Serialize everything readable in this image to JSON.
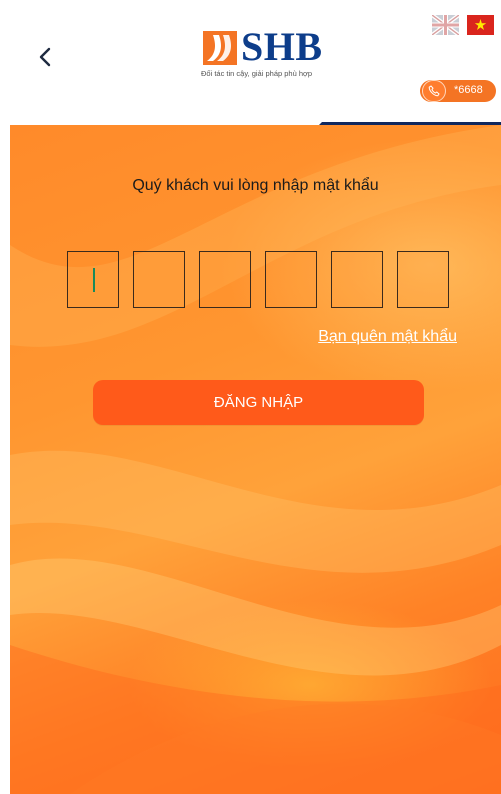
{
  "header": {
    "logo_text": "SHB",
    "logo_tagline": "Đối tác tin cậy, giải pháp phù hợp",
    "hotline_number": "*6668"
  },
  "login": {
    "prompt": "Quý khách vui lòng nhập mật khẩu",
    "pin_length": 6,
    "forgot_password_label": "Bạn quên mật khẩu",
    "login_button_label": "ĐĂNG NHẬP"
  },
  "colors": {
    "brand_blue": "#0d3d8a",
    "brand_orange": "#f47424",
    "button_orange": "#ff5a1a"
  },
  "icons": [
    "back-arrow-icon",
    "shb-logo-icon",
    "uk-flag-icon",
    "vietnam-flag-icon",
    "phone-icon"
  ]
}
